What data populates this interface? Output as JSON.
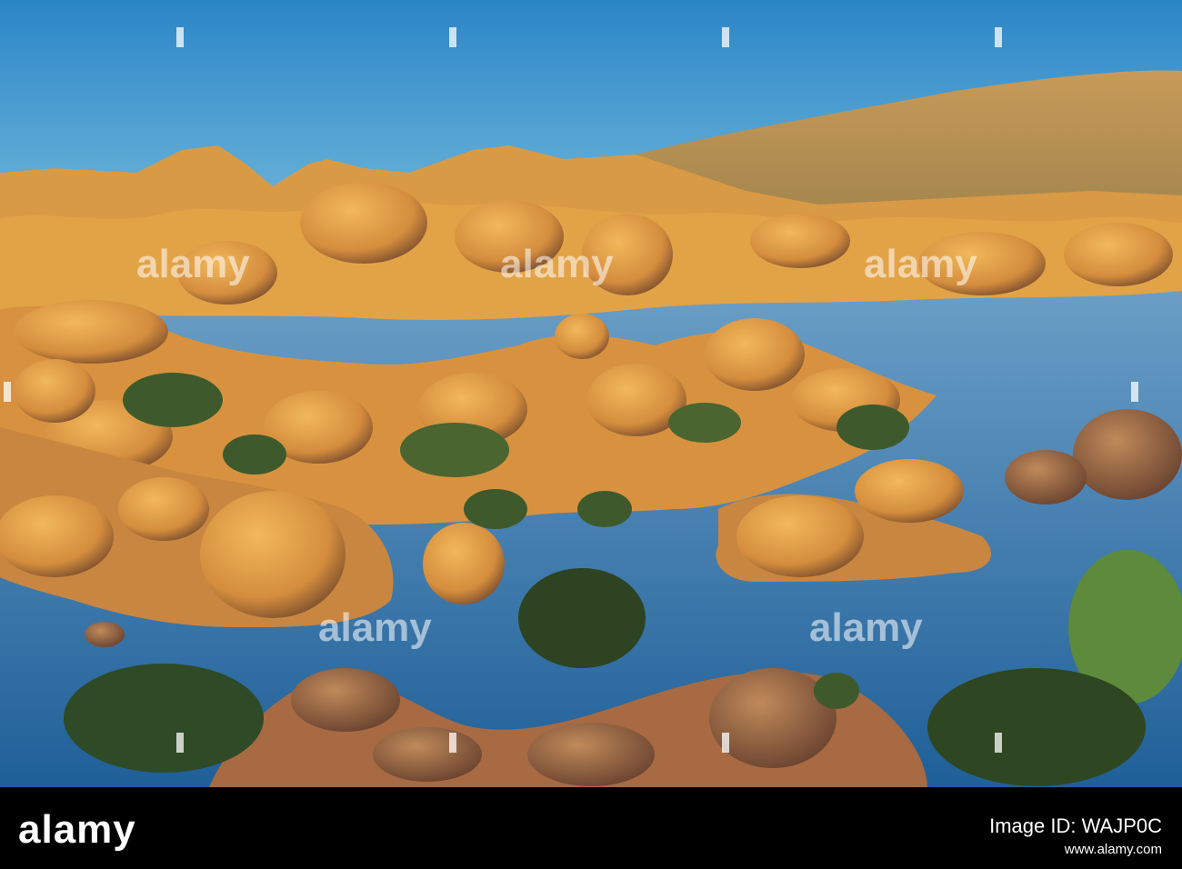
{
  "photo": {
    "subject": "granite boulders on lake",
    "colors": {
      "sky_top": "#2f8fcf",
      "sky_bottom": "#6ab8dc",
      "rock_lit": "#e9a646",
      "rock_shadow": "#8a5a3a",
      "water": "#2f6fa8",
      "shrub": "#3d5a2a"
    }
  },
  "watermark": {
    "text": "alamy"
  },
  "footer": {
    "brand": "alamy",
    "image_id_label": "Image ID: WAJP0C",
    "site": "www.alamy.com"
  }
}
